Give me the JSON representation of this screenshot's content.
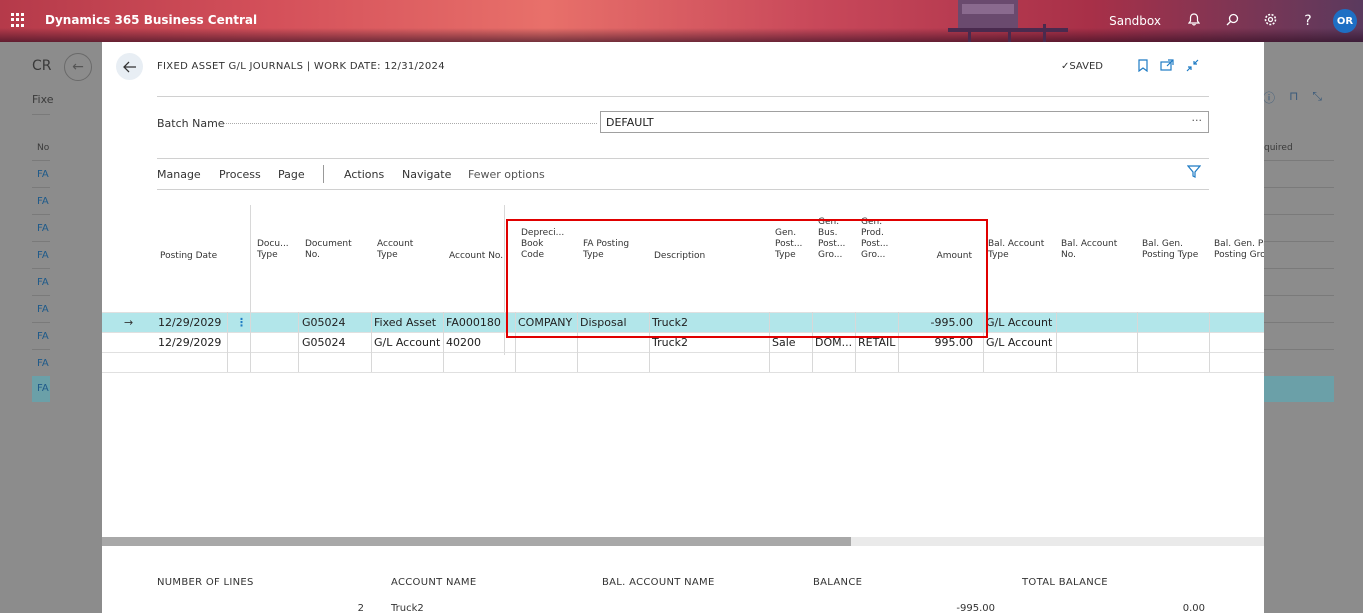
{
  "topbar": {
    "app_title": "Dynamics 365 Business Central",
    "environment": "Sandbox",
    "avatar_initials": "OR"
  },
  "background": {
    "title_fragment": "CR",
    "subtitle_fragment": "Fixe",
    "col_fragment": "No",
    "row_fragment": "FA",
    "right_col_fragment": "quired"
  },
  "dialog": {
    "title": "FIXED ASSET G/L JOURNALS | WORK DATE: 12/31/2024",
    "saved_label": "SAVED",
    "batch_label": "Batch Name",
    "batch_value": "DEFAULT",
    "actions": [
      "Manage",
      "Process",
      "Page",
      "Actions",
      "Navigate",
      "Fewer options"
    ]
  },
  "grid": {
    "headers": {
      "posting_date": "Posting Date",
      "doc_type_1": "Docu...",
      "doc_type_2": "Type",
      "doc_no_1": "Document",
      "doc_no_2": "No.",
      "acc_type_1": "Account",
      "acc_type_2": "Type",
      "acc_no": "Account No.",
      "depr_1": "Depreci...",
      "depr_2": "Book",
      "depr_3": "Code",
      "fa_post_1": "FA Posting",
      "fa_post_2": "Type",
      "description": "Description",
      "gen_post_1": "Gen.",
      "gen_post_2": "Post...",
      "gen_post_3": "Type",
      "gen_bus_1": "Gen.",
      "gen_bus_2": "Bus.",
      "gen_bus_3": "Post...",
      "gen_bus_4": "Gro...",
      "gen_prod_1": "Gen.",
      "gen_prod_2": "Prod.",
      "gen_prod_3": "Post...",
      "gen_prod_4": "Gro...",
      "amount": "Amount",
      "bal_acc_type_1": "Bal. Account",
      "bal_acc_type_2": "Type",
      "bal_acc_no_1": "Bal. Account",
      "bal_acc_no_2": "No.",
      "bal_gen_1": "Bal. Gen.",
      "bal_gen_2": "Posting Type",
      "bal_gen_pr_1": "Bal. Gen. Pr",
      "bal_gen_pr_2": "Posting Gro"
    },
    "rows": [
      {
        "posting_date": "12/29/2029",
        "doc_type": "",
        "doc_no": "G05024",
        "acc_type": "Fixed Asset",
        "acc_no": "FA000180",
        "depr_book": "COMPANY",
        "fa_posting_type": "Disposal",
        "description": "Truck2",
        "gen_post_type": "",
        "gen_bus": "",
        "gen_prod": "",
        "amount": "-995.00",
        "bal_acc_type": "G/L Account"
      },
      {
        "posting_date": "12/29/2029",
        "doc_type": "",
        "doc_no": "G05024",
        "acc_type": "G/L Account",
        "acc_no": "40200",
        "depr_book": "",
        "fa_posting_type": "",
        "description": "Truck2",
        "gen_post_type": "Sale",
        "gen_bus": "DOM...",
        "gen_prod": "RETAIL",
        "amount": "995.00",
        "bal_acc_type": "G/L Account"
      }
    ]
  },
  "footer": {
    "labels": {
      "lines": "NUMBER OF LINES",
      "account_name": "ACCOUNT NAME",
      "bal_account_name": "BAL. ACCOUNT NAME",
      "balance": "BALANCE",
      "total_balance": "TOTAL BALANCE"
    },
    "values": {
      "lines": "2",
      "account_name": "Truck2",
      "balance": "-995.00",
      "total_balance": "0.00"
    }
  },
  "colors": {
    "selected_row": "#b2e6ea",
    "accent": "#1e7bc4",
    "highlight": "#e00000"
  }
}
